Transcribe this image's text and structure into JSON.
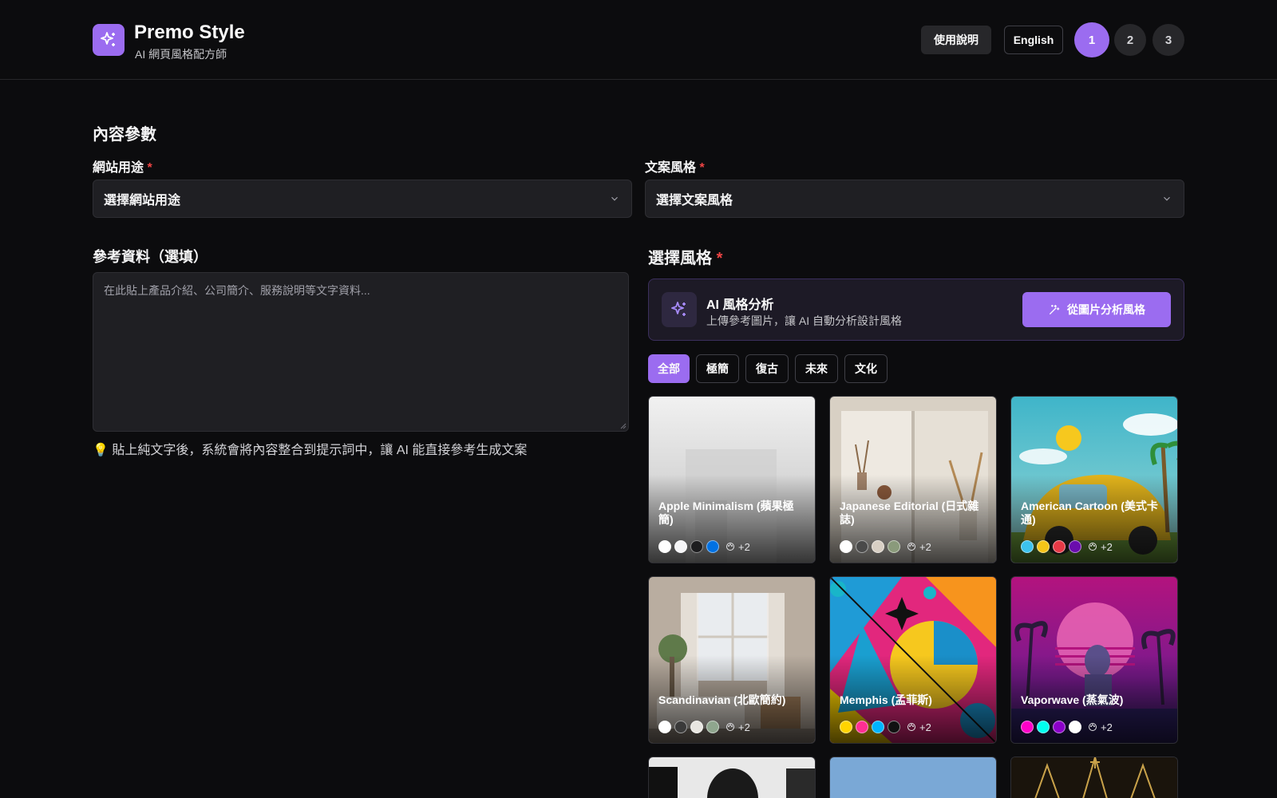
{
  "header": {
    "brand_title": "Premo Style",
    "brand_subtitle": "AI 網頁風格配方師",
    "help_label": "使用說明",
    "lang_label": "English",
    "steps": [
      "1",
      "2",
      "3"
    ],
    "active_step": "1"
  },
  "content": {
    "section_title": "內容參數",
    "purpose_label": "網站用途",
    "purpose_value": "選擇網站用途",
    "copy_label": "文案風格",
    "copy_value": "選擇文案風格",
    "required_mark": "*",
    "reference_title": "參考資料（選填）",
    "reference_placeholder": "在此貼上產品介紹、公司簡介、服務說明等文字資料...",
    "hint": "💡 貼上純文字後，系統會將內容整合到提示詞中，讓 AI 能直接參考生成文案"
  },
  "styles": {
    "title": "選擇風格",
    "ai_title": "AI 風格分析",
    "ai_desc": "上傳參考圖片，讓 AI 自動分析設計風格",
    "ai_button": "從圖片分析風格",
    "filters": [
      "全部",
      "極簡",
      "復古",
      "未來",
      "文化"
    ],
    "active_filter": "全部",
    "cards": [
      {
        "name": "Apple Minimalism (蘋果極簡)",
        "colors": [
          "#ffffff",
          "#f5f5f7",
          "#1d1d1f",
          "#0071e3"
        ],
        "more": "+2"
      },
      {
        "name": "Japanese Editorial (日式雜誌)",
        "colors": [
          "#ffffff",
          "#4a4a4a",
          "#d8cfc4",
          "#8a9a7b"
        ],
        "more": "+2"
      },
      {
        "name": "American Cartoon (美式卡通)",
        "colors": [
          "#3cc3ee",
          "#f5c518",
          "#e63946",
          "#6a0dad"
        ],
        "more": "+2"
      },
      {
        "name": "Scandinavian (北歐簡約)",
        "colors": [
          "#ffffff",
          "#3a3a3a",
          "#e8e6e1",
          "#8fa68e"
        ],
        "more": "+2"
      },
      {
        "name": "Memphis (孟菲斯)",
        "colors": [
          "#ffd400",
          "#ff2e93",
          "#00b4ff",
          "#111111"
        ],
        "more": "+2"
      },
      {
        "name": "Vaporwave (蒸氣波)",
        "colors": [
          "#ff00c8",
          "#00fff0",
          "#8b00c9",
          "#ffffff"
        ],
        "more": "+2"
      }
    ]
  }
}
